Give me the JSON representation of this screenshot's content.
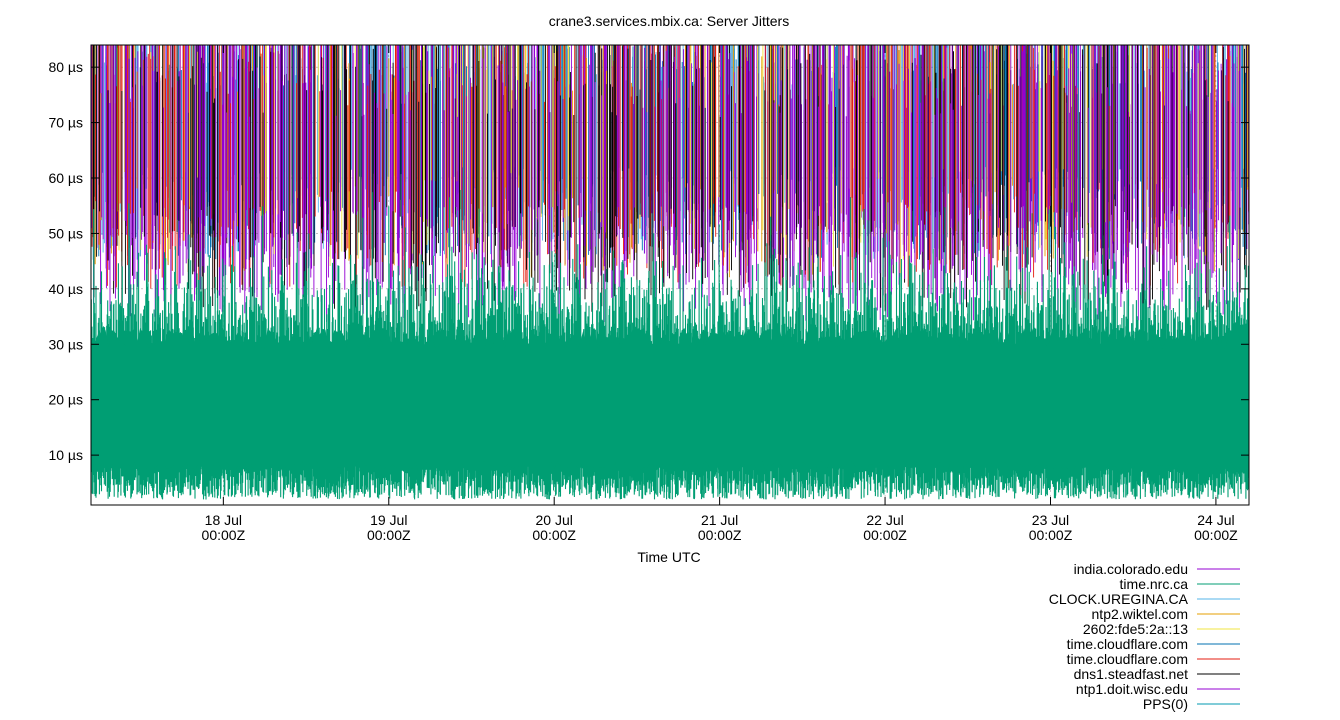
{
  "chart_data": {
    "type": "line",
    "title": "crane3.services.mbix.ca: Server Jitters",
    "xlabel": "Time UTC",
    "ylabel": "",
    "x_range_days": [
      17.2,
      24.2
    ],
    "ylim": [
      1,
      84
    ],
    "y_unit": "µs",
    "grid": true,
    "legend_position": "bottom-right",
    "y_ticks": [
      {
        "value": 10,
        "label": "10 µs"
      },
      {
        "value": 20,
        "label": "20 µs"
      },
      {
        "value": 30,
        "label": "30 µs"
      },
      {
        "value": 40,
        "label": "40 µs"
      },
      {
        "value": 50,
        "label": "50 µs"
      },
      {
        "value": 60,
        "label": "60 µs"
      },
      {
        "value": 70,
        "label": "70 µs"
      },
      {
        "value": 80,
        "label": "80 µs"
      }
    ],
    "x_ticks": [
      {
        "value": 18,
        "label1": "18 Jul",
        "label2": "00:00Z"
      },
      {
        "value": 19,
        "label1": "19 Jul",
        "label2": "00:00Z"
      },
      {
        "value": 20,
        "label1": "20 Jul",
        "label2": "00:00Z"
      },
      {
        "value": 21,
        "label1": "21 Jul",
        "label2": "00:00Z"
      },
      {
        "value": 22,
        "label1": "22 Jul",
        "label2": "00:00Z"
      },
      {
        "value": 23,
        "label1": "23 Jul",
        "label2": "00:00Z"
      },
      {
        "value": 24,
        "label1": "24 Jul",
        "label2": "00:00Z"
      }
    ],
    "series": [
      {
        "name": "india.colorado.edu",
        "color": "#9400d3",
        "baseline": 55,
        "spread": 35,
        "density": 0.35,
        "top_heavy": true
      },
      {
        "name": "time.nrc.ca",
        "color": "#009e73",
        "baseline": 22,
        "spread": 22,
        "density": 1.0,
        "top_heavy": false
      },
      {
        "name": "CLOCK.UREGINA.CA",
        "color": "#56b4e9",
        "baseline": 62,
        "spread": 28,
        "density": 0.45,
        "top_heavy": true
      },
      {
        "name": "ntp2.wiktel.com",
        "color": "#e69f00",
        "baseline": 60,
        "spread": 30,
        "density": 0.2,
        "top_heavy": true
      },
      {
        "name": "2602:fde5:2a::13",
        "color": "#f0e442",
        "baseline": 62,
        "spread": 30,
        "density": 0.15,
        "top_heavy": true
      },
      {
        "name": "time.cloudflare.com",
        "color": "#0072b2",
        "baseline": 62,
        "spread": 28,
        "density": 0.4,
        "top_heavy": true
      },
      {
        "name": "time.cloudflare.com",
        "color": "#e51e10",
        "baseline": 58,
        "spread": 30,
        "density": 0.3,
        "top_heavy": true
      },
      {
        "name": "dns1.steadfast.net",
        "color": "#000000",
        "baseline": 55,
        "spread": 32,
        "density": 0.35,
        "top_heavy": true
      },
      {
        "name": "ntp1.doit.wisc.edu",
        "color": "#9400d3",
        "baseline": 55,
        "spread": 32,
        "density": 0.35,
        "top_heavy": true
      },
      {
        "name": "PPS(0)",
        "color": "#009ab0",
        "baseline": 0,
        "spread": 0,
        "density": 0.0,
        "top_heavy": false
      }
    ]
  }
}
